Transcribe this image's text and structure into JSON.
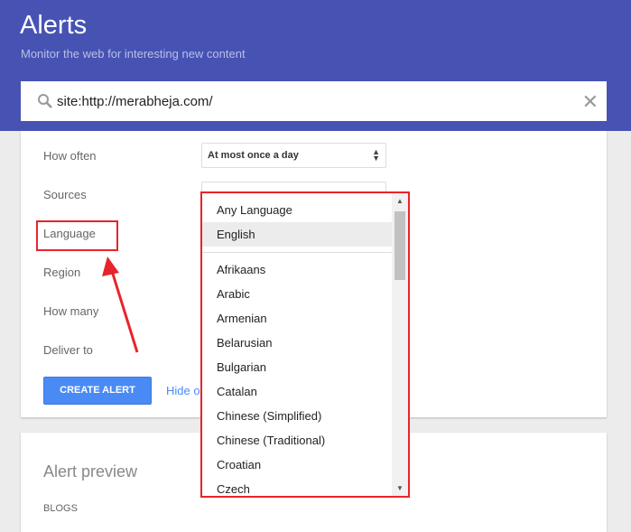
{
  "header": {
    "title": "Alerts",
    "subtitle": "Monitor the web for interesting new content"
  },
  "search": {
    "value": "site:http://merabheja.com/",
    "clear": "✕"
  },
  "options": {
    "how_often": {
      "label": "How often",
      "value": "At most once a day"
    },
    "sources": {
      "label": "Sources"
    },
    "language": {
      "label": "Language"
    },
    "region": {
      "label": "Region"
    },
    "how_many": {
      "label": "How many"
    },
    "deliver_to": {
      "label": "Deliver to"
    },
    "create_button": "CREATE ALERT",
    "hide_options": "Hide op"
  },
  "language_dropdown": {
    "top": [
      "Any Language",
      "English"
    ],
    "items": [
      "Afrikaans",
      "Arabic",
      "Armenian",
      "Belarusian",
      "Bulgarian",
      "Catalan",
      "Chinese (Simplified)",
      "Chinese (Traditional)",
      "Croatian",
      "Czech"
    ],
    "selected": "English"
  },
  "preview": {
    "title": "Alert preview",
    "section": "BLOGS"
  },
  "colors": {
    "header": "#4753b3",
    "accent": "#4a8af4",
    "annotation": "#e8242b"
  }
}
